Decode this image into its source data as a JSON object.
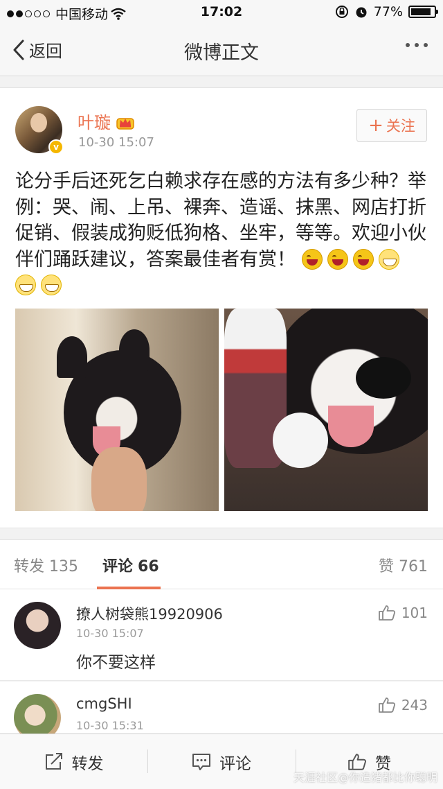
{
  "status_bar": {
    "carrier": "中国移动",
    "time": "17:02",
    "battery": "77%",
    "signal_bars_filled": 2,
    "battery_level": 0.77
  },
  "nav": {
    "back_label": "返回",
    "title": "微博正文"
  },
  "post": {
    "author": "叶璇",
    "verified_badge": "v",
    "time": "10-30 15:07",
    "follow_label": "关注",
    "text": "论分手后还死乞白赖求存在感的方法有多少种？举例：哭、闹、上吊、裸奔、造谣、抹黑、网店打折促销、假装成狗贬低狗格、坐牢，等等。欢迎小伙伴们踊跃建议，答案最佳者有赏！",
    "emoji_icons": [
      "laugh-emoji",
      "laugh-emoji",
      "laugh-emoji",
      "grin-emoji",
      "grin-emoji",
      "grin-emoji"
    ],
    "photos": [
      "husky-photo-left",
      "husky-photo-right"
    ]
  },
  "tabs": {
    "repost_label": "转发",
    "repost_count": "135",
    "comment_label": "评论",
    "comment_count": "66",
    "like_label": "赞",
    "like_count": "761"
  },
  "comments": [
    {
      "name": "撩人树袋熊19920906",
      "time": "10-30 15:07",
      "text": "你不要这样",
      "likes": "101"
    },
    {
      "name": "cmgSHI",
      "time": "10-30 15:31",
      "text": "",
      "likes": "243"
    }
  ],
  "toolbar": {
    "repost_label": "转发",
    "comment_label": "评论",
    "like_label": "赞"
  },
  "watermark": "天涯社区@你造猪都比你聪明",
  "colors": {
    "accent": "#eb7350",
    "verified": "#f5b700"
  }
}
